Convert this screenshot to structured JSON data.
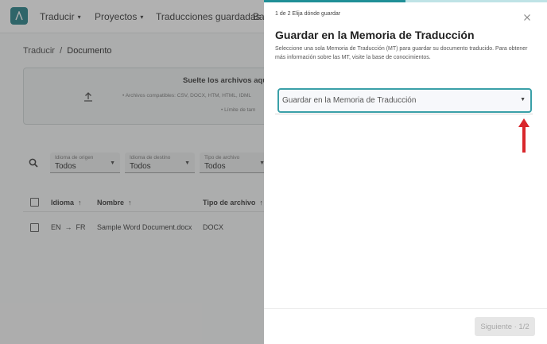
{
  "nav": {
    "items": [
      {
        "label": "Traducir",
        "chevron": "▾"
      },
      {
        "label": "Proyectos",
        "chevron": "▾"
      },
      {
        "label": "Traducciones guardadas"
      },
      {
        "label": "Ba"
      }
    ]
  },
  "breadcrumb": {
    "parent": "Traducir",
    "separator": "/",
    "current": "Documento"
  },
  "dropzone": {
    "title": "Suelte los archivos aquí o h",
    "line1": "•   Archivos compatibles: CSV, DOCX, HTM, HTML, IDML",
    "line2": "•   Límite de tam"
  },
  "filters": [
    {
      "label": "Idioma de origen",
      "value": "Todos"
    },
    {
      "label": "Idioma de destino",
      "value": "Todos"
    },
    {
      "label": "Tipo de archivo",
      "value": "Todos"
    }
  ],
  "table": {
    "columns": [
      "Idioma",
      "Nombre",
      "Tipo de archivo"
    ],
    "sort_icon": "↑",
    "rows": [
      {
        "source": "EN",
        "arrow": "→",
        "target": "FR",
        "name": "Sample Word Document.docx",
        "type": "DOCX"
      }
    ]
  },
  "panel": {
    "progress": 0.5,
    "step_text": "1 de 2 Elija dónde guardar",
    "title": "Guardar en la Memoria de Traducción",
    "description": "Seleccione una sola Memoria de Traducción (MT) para guardar su documento traducido. Para obtener más información sobre las MT, visite la base de conocimientos.",
    "select_value": "Guardar en la Memoria de Traducción",
    "next_label": "Siguiente · 1/2"
  },
  "colors": {
    "accent": "#1f8f97",
    "select_border": "#3aa0a8",
    "annotation_arrow": "#d9262b"
  }
}
